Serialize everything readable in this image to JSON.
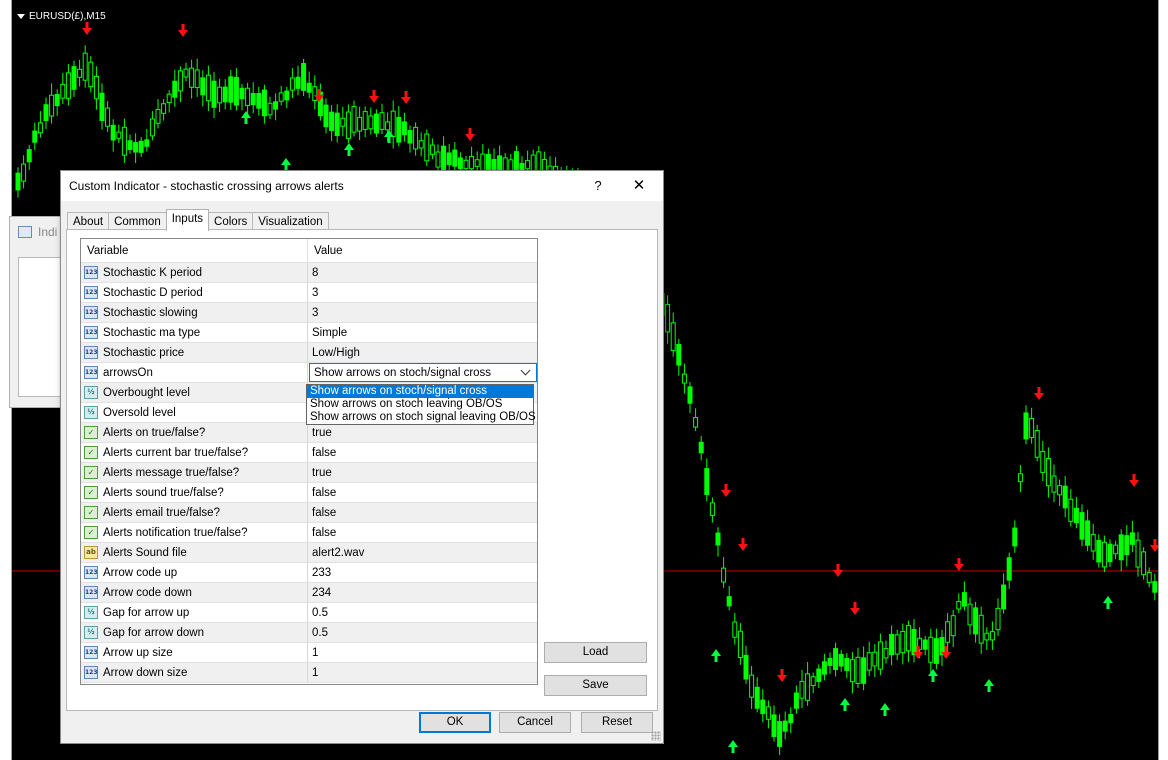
{
  "chart": {
    "symbol_label": "EURUSD(£),M15",
    "colors": {
      "background": "#000000",
      "candle": "#00ff00",
      "arrow_up": "#00ff40",
      "arrow_down": "#ff1010",
      "level_line": "#c80000"
    }
  },
  "background_window": {
    "title": "Indi"
  },
  "dialog": {
    "title": "Custom Indicator - stochastic crossing arrows alerts",
    "help_label": "?",
    "close_label": "✕",
    "tabs": [
      {
        "label": "About",
        "active": false
      },
      {
        "label": "Common",
        "active": false
      },
      {
        "label": "Inputs",
        "active": true
      },
      {
        "label": "Colors",
        "active": false
      },
      {
        "label": "Visualization",
        "active": false
      }
    ],
    "grid": {
      "col_variable": "Variable",
      "col_value": "Value",
      "rows": [
        {
          "type": "int",
          "icon": "123",
          "name": "Stochastic K period",
          "value": "8"
        },
        {
          "type": "int",
          "icon": "123",
          "name": "Stochastic D period",
          "value": "3"
        },
        {
          "type": "int",
          "icon": "123",
          "name": "Stochastic slowing",
          "value": "3"
        },
        {
          "type": "int",
          "icon": "123",
          "name": "Stochastic ma type",
          "value": "Simple"
        },
        {
          "type": "int",
          "icon": "123",
          "name": "Stochastic price",
          "value": "Low/High"
        },
        {
          "type": "int",
          "icon": "123",
          "name": "arrowsOn",
          "value": "Show arrows on stoch/signal cross",
          "editing": true
        },
        {
          "type": "dbl",
          "icon": "½",
          "name": "Overbought level",
          "value": ""
        },
        {
          "type": "dbl",
          "icon": "½",
          "name": "Oversold level",
          "value": ""
        },
        {
          "type": "bool",
          "icon": "✓",
          "name": "Alerts on true/false?",
          "value": "true"
        },
        {
          "type": "bool",
          "icon": "✓",
          "name": "Alerts current bar true/false?",
          "value": "false"
        },
        {
          "type": "bool",
          "icon": "✓",
          "name": "Alerts message true/false?",
          "value": "true"
        },
        {
          "type": "bool",
          "icon": "✓",
          "name": "Alerts sound true/false?",
          "value": "false"
        },
        {
          "type": "bool",
          "icon": "✓",
          "name": "Alerts email true/false?",
          "value": "false"
        },
        {
          "type": "bool",
          "icon": "✓",
          "name": "Alerts notification true/false?",
          "value": "false"
        },
        {
          "type": "str",
          "icon": "ab",
          "name": "Alerts Sound file",
          "value": "alert2.wav"
        },
        {
          "type": "int",
          "icon": "123",
          "name": "Arrow code up",
          "value": "233"
        },
        {
          "type": "int",
          "icon": "123",
          "name": "Arrow code down",
          "value": "234"
        },
        {
          "type": "dbl",
          "icon": "½",
          "name": "Gap for arrow up",
          "value": "0.5"
        },
        {
          "type": "dbl",
          "icon": "½",
          "name": "Gap for arrow down",
          "value": "0.5"
        },
        {
          "type": "int",
          "icon": "123",
          "name": "Arrow up size",
          "value": "1"
        },
        {
          "type": "int",
          "icon": "123",
          "name": "Arrow down size",
          "value": "1"
        }
      ]
    },
    "dropdown_options": [
      {
        "label": "Show arrows on stoch/signal cross",
        "selected": true
      },
      {
        "label": "Show arrows on stoch leaving OB/OS",
        "selected": false
      },
      {
        "label": "Show arrows on stoch signal leaving OB/OS",
        "selected": false
      }
    ],
    "buttons": {
      "load": "Load",
      "save": "Save",
      "ok": "OK",
      "cancel": "Cancel",
      "reset": "Reset"
    }
  }
}
